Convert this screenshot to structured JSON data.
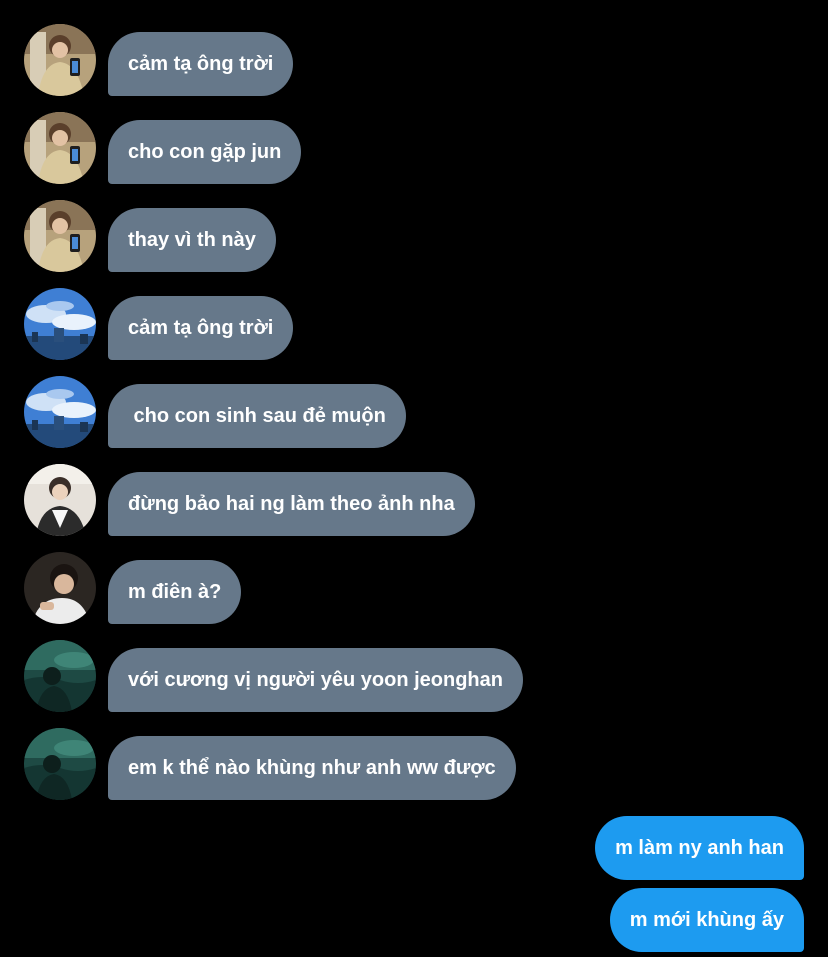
{
  "colors": {
    "background": "#000000",
    "received_bubble": "#66788a",
    "sent_bubble": "#1d9bf0",
    "text": "#ffffff"
  },
  "received": [
    {
      "avatar": "avatar-boy-phone-mirror",
      "text": "cảm tạ ông trời"
    },
    {
      "avatar": "avatar-boy-phone-mirror",
      "text": "cho con gặp jun"
    },
    {
      "avatar": "avatar-boy-phone-mirror",
      "text": "thay vì th này"
    },
    {
      "avatar": "avatar-blue-sky",
      "text": "cảm tạ ông trời"
    },
    {
      "avatar": "avatar-blue-sky",
      "text": " cho con sinh sau đẻ muộn"
    },
    {
      "avatar": "avatar-boy-light-room",
      "text": "đừng bảo hai ng làm theo ảnh nha"
    },
    {
      "avatar": "avatar-boy-dark-portrait",
      "text": "m điên à?"
    },
    {
      "avatar": "avatar-dark-teal-water",
      "text": "với cương vị người yêu yoon jeonghan"
    },
    {
      "avatar": "avatar-dark-teal-water",
      "text": "em k thể nào khùng như anh ww được"
    }
  ],
  "sent": [
    {
      "text": "m làm ny anh han"
    },
    {
      "text": "m mới khùng ấy"
    }
  ]
}
